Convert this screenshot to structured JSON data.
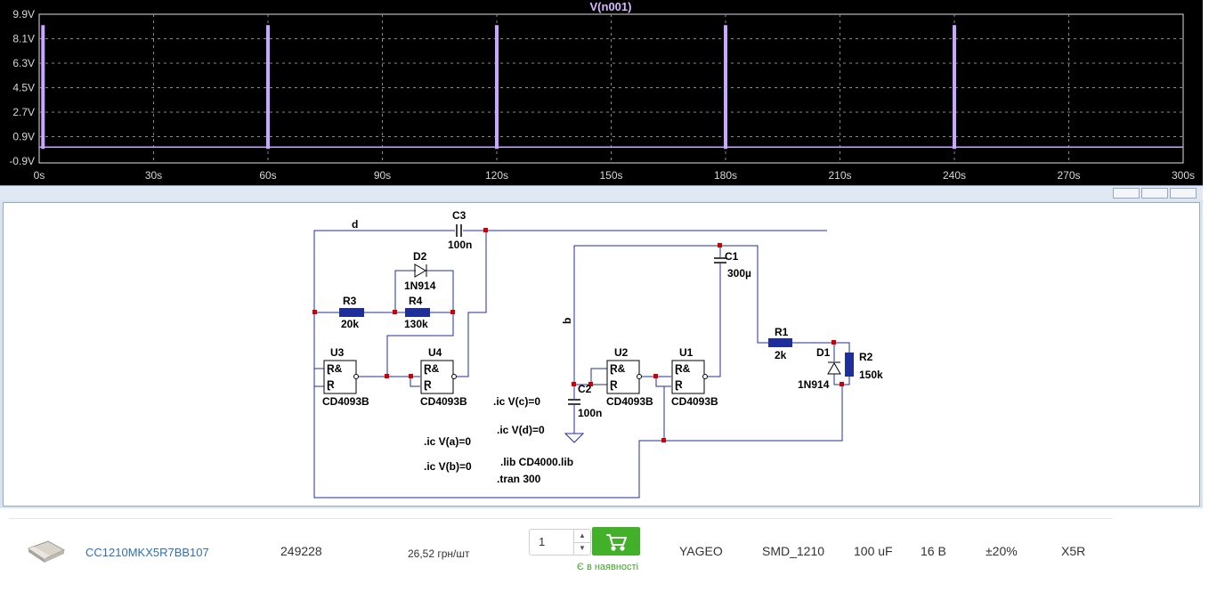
{
  "waveform": {
    "trace_title": "V(n001)",
    "y_ticks": [
      "9.9V",
      "8.1V",
      "6.3V",
      "4.5V",
      "2.7V",
      "0.9V",
      "-0.9V"
    ],
    "x_ticks": [
      "0s",
      "30s",
      "60s",
      "90s",
      "120s",
      "150s",
      "180s",
      "210s",
      "240s",
      "270s",
      "300s"
    ],
    "trace_color": "#c9a6ff"
  },
  "chart_data": {
    "type": "line",
    "title": "V(n001)",
    "xlabel": "",
    "ylabel": "",
    "xlim": [
      0,
      300
    ],
    "ylim": [
      -0.9,
      9.9
    ],
    "x_unit": "s",
    "y_unit": "V",
    "grid": true,
    "series": [
      {
        "name": "V(n001)",
        "pulses_at_x": [
          1,
          60,
          120,
          180,
          240
        ],
        "high_value": 9.1,
        "low_value": 0.0
      }
    ]
  },
  "schematic": {
    "labels": {
      "d": "d",
      "b": "b",
      "C3": "C3",
      "C3_val": "100n",
      "D2": "D2",
      "D2_val": "1N914",
      "R3": "R3",
      "R3_val": "20k",
      "R4": "R4",
      "R4_val": "130k",
      "U3": "U3",
      "U3_val": "CD4093B",
      "U4": "U4",
      "U4_val": "CD4093B",
      "U2": "U2",
      "U2_val": "CD4093B",
      "U1": "U1",
      "U1_val": "CD4093B",
      "C2": "C2",
      "C2_val": "100n",
      "C1": "C1",
      "C1_val": "300µ",
      "R1": "R1",
      "R1_val": "2k",
      "R2": "R2",
      "R2_val": "150k",
      "D1": "D1",
      "D1_val": "1N914"
    },
    "directives": {
      "ic_c": ".ic V(c)=0",
      "ic_d": ".ic V(d)=0",
      "ic_a": ".ic V(a)=0",
      "ic_b": ".ic V(b)=0",
      "lib": ".lib CD4000.lib",
      "tran": ".tran 300"
    },
    "gate_symbol": "Ɽ&"
  },
  "product": {
    "part_number": "CC1210MKX5R7BB107",
    "code": "249228",
    "price": "26,52 грн/шт",
    "quantity": "1",
    "stock_status": "Є в наявності",
    "manufacturer": "YAGEO",
    "package": "SMD_1210",
    "capacitance": "100 uF",
    "voltage": "16 В",
    "tolerance": "±20%",
    "dielectric": "X5R",
    "cart_color": "#43b02a"
  }
}
